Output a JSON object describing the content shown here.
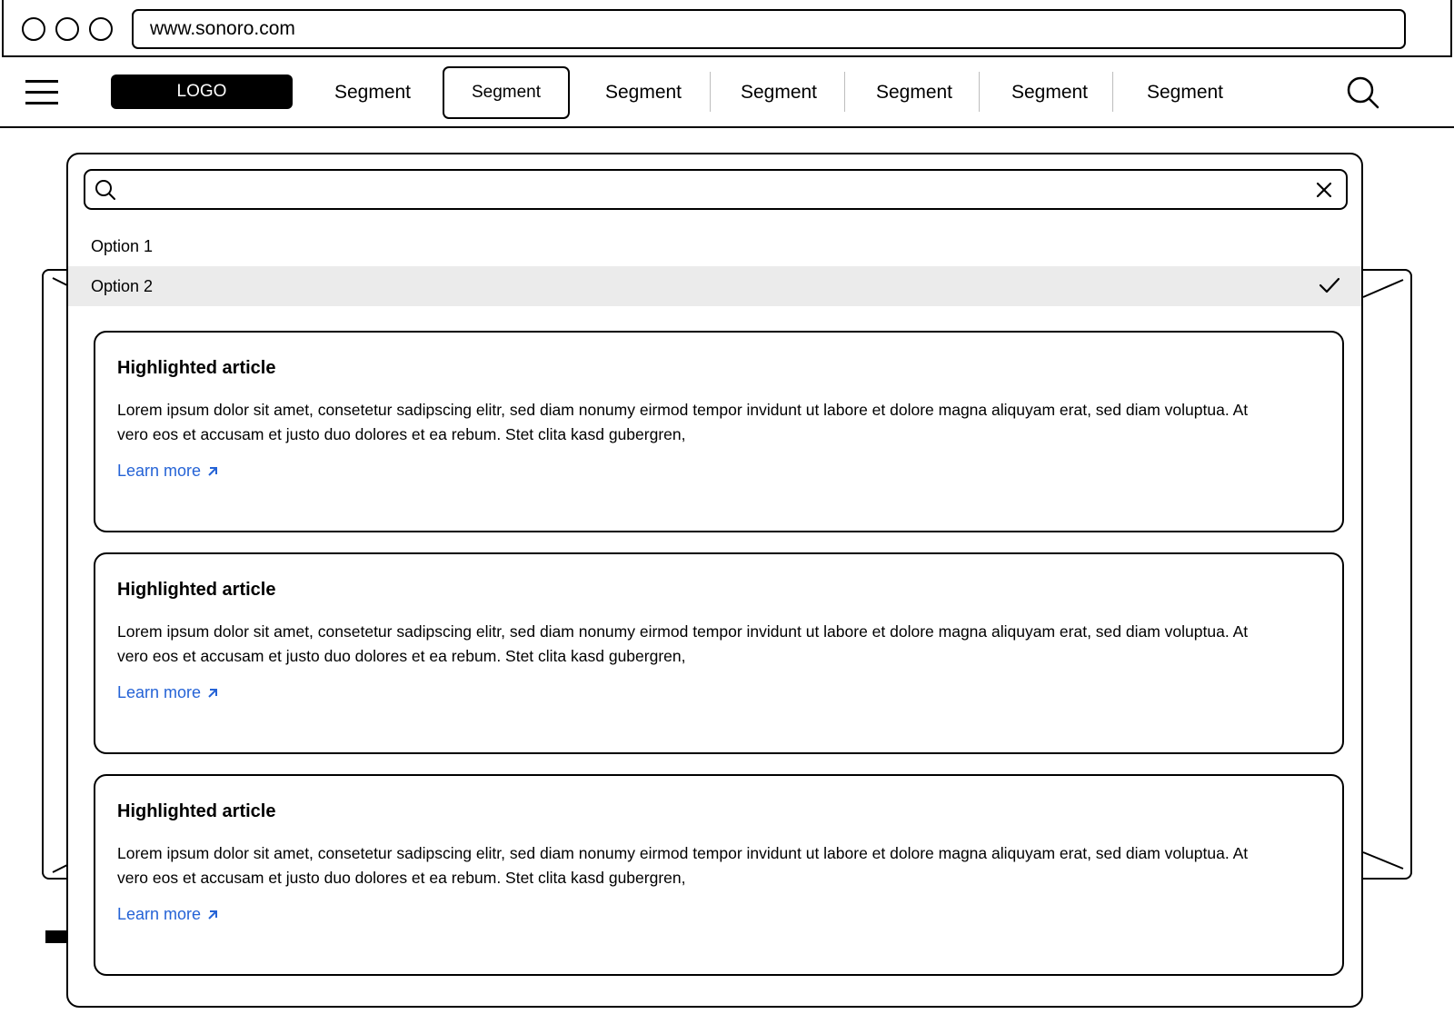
{
  "browser": {
    "url": "www.sonoro.com"
  },
  "nav": {
    "logo": "LOGO",
    "segments": [
      "Segment",
      "Segment",
      "Segment",
      "Segment",
      "Segment",
      "Segment",
      "Segment"
    ],
    "active_index": 1
  },
  "dropdown": {
    "search_value": "",
    "options": [
      {
        "label": "Option 1",
        "selected": false
      },
      {
        "label": "Option 2",
        "selected": true
      }
    ],
    "articles": [
      {
        "title": "Highlighted article",
        "body": "Lorem ipsum dolor sit amet, consetetur sadipscing elitr, sed diam nonumy eirmod tempor invidunt ut labore et dolore magna aliquyam erat, sed diam voluptua. At vero eos et accusam et justo duo dolores et ea rebum. Stet clita kasd gubergren,",
        "link": "Learn more"
      },
      {
        "title": "Highlighted article",
        "body": "Lorem ipsum dolor sit amet, consetetur sadipscing elitr, sed diam nonumy eirmod tempor invidunt ut labore et dolore magna aliquyam erat, sed diam voluptua. At vero eos et accusam et justo duo dolores et ea rebum. Stet clita kasd gubergren,",
        "link": "Learn more"
      },
      {
        "title": "Highlighted article",
        "body": "Lorem ipsum dolor sit amet, consetetur sadipscing elitr, sed diam nonumy eirmod tempor invidunt ut labore et dolore magna aliquyam erat, sed diam voluptua. At vero eos et accusam et justo duo dolores et ea rebum. Stet clita kasd gubergren,",
        "link": "Learn more"
      }
    ]
  },
  "colors": {
    "link": "#2563d6",
    "selected_option_bg": "#ebebeb",
    "logo_bg": "#000000"
  },
  "icons": {
    "menu": "hamburger-icon",
    "search": "search-icon",
    "clear": "close-icon",
    "selected": "check-icon",
    "external": "arrow-up-right-icon"
  }
}
